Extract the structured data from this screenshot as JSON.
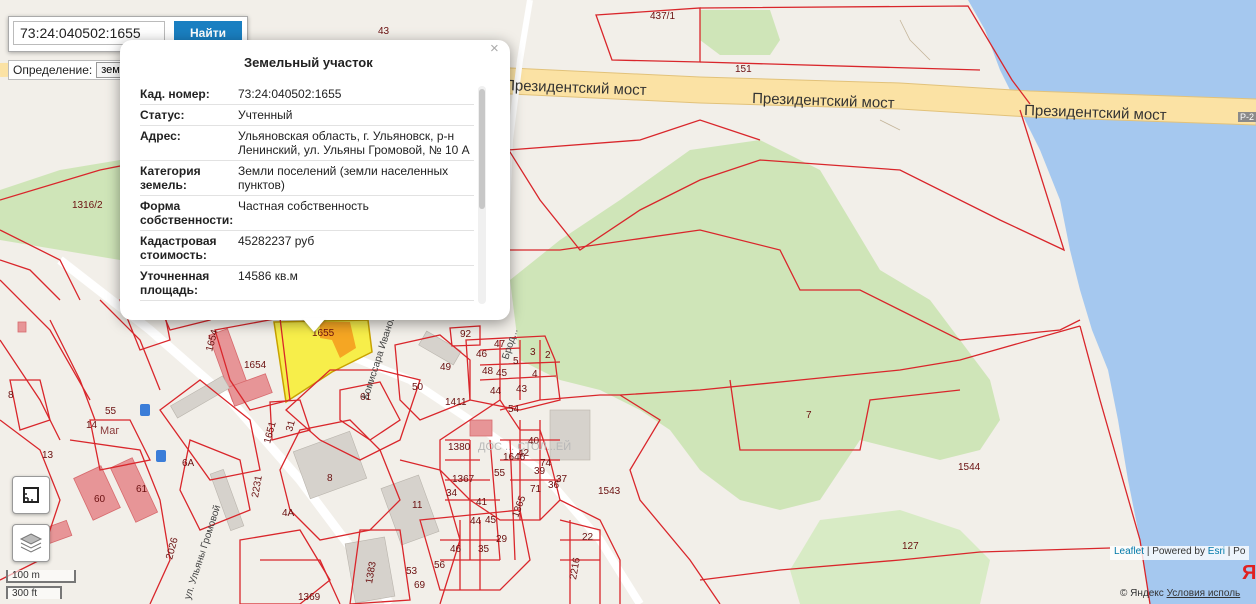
{
  "search": {
    "value": "73:24:040502:1655",
    "button_label": "Найти"
  },
  "definition": {
    "label": "Определение:",
    "selected": "земельный участок"
  },
  "popup": {
    "title": "Земельный участок",
    "rows": [
      {
        "key": "Кад. номер:",
        "value": "73:24:040502:1655"
      },
      {
        "key": "Статус:",
        "value": "Учтенный"
      },
      {
        "key": "Адрес:",
        "value": "Ульяновская область, г. Ульяновск, р-н Ленинский, ул. Ульяны Громовой, № 10 А"
      },
      {
        "key": "Категория земель:",
        "value": "Земли поселений (земли населенных пунктов)"
      },
      {
        "key": "Форма собственности:",
        "value": "Частная собственность"
      },
      {
        "key": "Кадастровая стоимость:",
        "value": "45282237 руб"
      },
      {
        "key": "Уточненная площадь:",
        "value": "14586 кв.м"
      }
    ],
    "close_symbol": "×"
  },
  "map": {
    "roads": [
      {
        "label": "Президентский мост"
      },
      {
        "label": "Президентский мост"
      },
      {
        "label": "Президентский мост"
      }
    ],
    "streets": [
      {
        "label": "Комиссара Иванова"
      },
      {
        "label": "ул. Ульяны Громовой"
      },
      {
        "label": "Брод..."
      }
    ],
    "plot_numbers": [
      "43",
      "437/1",
      "151",
      "1316/2",
      "1655",
      "1654",
      "1654",
      "92",
      "49",
      "47",
      "46",
      "3",
      "2",
      "4",
      "5",
      "48",
      "45",
      "44",
      "43",
      "50",
      "1411",
      "54",
      "61",
      "1651",
      "31",
      "8",
      "1380",
      "1367",
      "55",
      "41",
      "40",
      "74",
      "36",
      "37",
      "71",
      "1646",
      "42",
      "39",
      "34",
      "44",
      "45",
      "1365",
      "46",
      "35",
      "29",
      "53",
      "69",
      "56",
      "11",
      "1383",
      "1369",
      "1543",
      "22",
      "2216",
      "1544",
      "7",
      "127",
      "60",
      "61",
      "2026",
      "13",
      "14",
      "55",
      "8",
      "2231",
      "6А",
      "4А"
    ],
    "poi_labels": [
      "Маг",
      "ДОС ... СТОЛ...ЕЙ"
    ],
    "route_sign": "Р-2"
  },
  "scale": {
    "metric": "100 m",
    "imperial": "300 ft"
  },
  "attribution": {
    "leaflet": "Leaflet",
    "powered": "| Powered by",
    "esri": "Esri",
    "extra": "| Po"
  },
  "yandex": {
    "copyright": "© Яндекс",
    "terms": "Условия исполь",
    "logo": "Я"
  },
  "colors": {
    "parcel_border": "#d9262b",
    "selected_parcel": "#f7ee4a",
    "water": "#a5c8ef",
    "forest": "#cfe5b8",
    "road": "#fbe2a4",
    "building": "#e79597"
  },
  "icons": [
    "layers-icon",
    "ruler-icon",
    "close-icon",
    "dropdown-arrow-icon"
  ]
}
